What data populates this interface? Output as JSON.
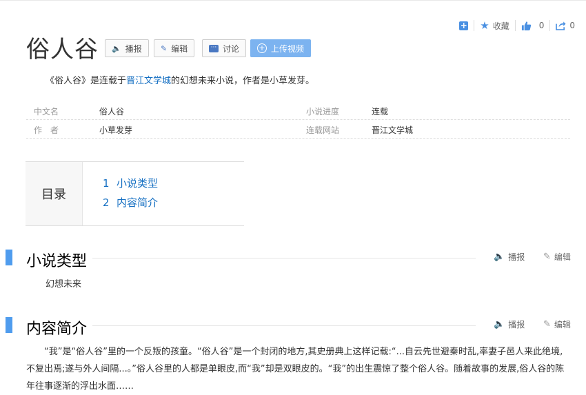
{
  "top_actions": {
    "favorite_label": "收藏",
    "like_count": "0",
    "share_count": "0"
  },
  "title": "俗人谷",
  "buttons": {
    "broadcast": "播报",
    "edit": "编辑",
    "discuss": "讨论",
    "upload_video": "上传视频"
  },
  "intro": {
    "prefix": "《俗人谷》是连载于",
    "link": "晋江文学城",
    "suffix": "的幻想未来小说，作者是小草发芽。"
  },
  "info": {
    "left": [
      {
        "key": "中文名",
        "value": "俗人谷"
      },
      {
        "key": "作　者",
        "value": "小草发芽"
      }
    ],
    "right": [
      {
        "key": "小说进度",
        "value": "连载"
      },
      {
        "key": "连载网站",
        "value": "晋江文学城"
      }
    ]
  },
  "toc": {
    "label": "目录",
    "items": [
      {
        "num": "1",
        "label": "小说类型"
      },
      {
        "num": "2",
        "label": "内容简介"
      }
    ]
  },
  "sections": [
    {
      "title": "小说类型",
      "broadcast": "播报",
      "edit": "编辑",
      "body": "幻想未来"
    },
    {
      "title": "内容简介",
      "broadcast": "播报",
      "edit": "编辑",
      "body": "“我”是“俗人谷”里的一个反叛的孩童。“俗人谷”是一个封闭的地方,其史册典上这样记载:“...自云先世避秦时乱,率妻子邑人来此绝境,不复出焉;遂与外人间隔...。”俗人谷里的人都是单眼皮,而“我”却是双眼皮的。“我”的出生震惊了整个俗人谷。随着故事的发展,俗人谷的陈年往事逐渐的浮出水面……"
    }
  ]
}
